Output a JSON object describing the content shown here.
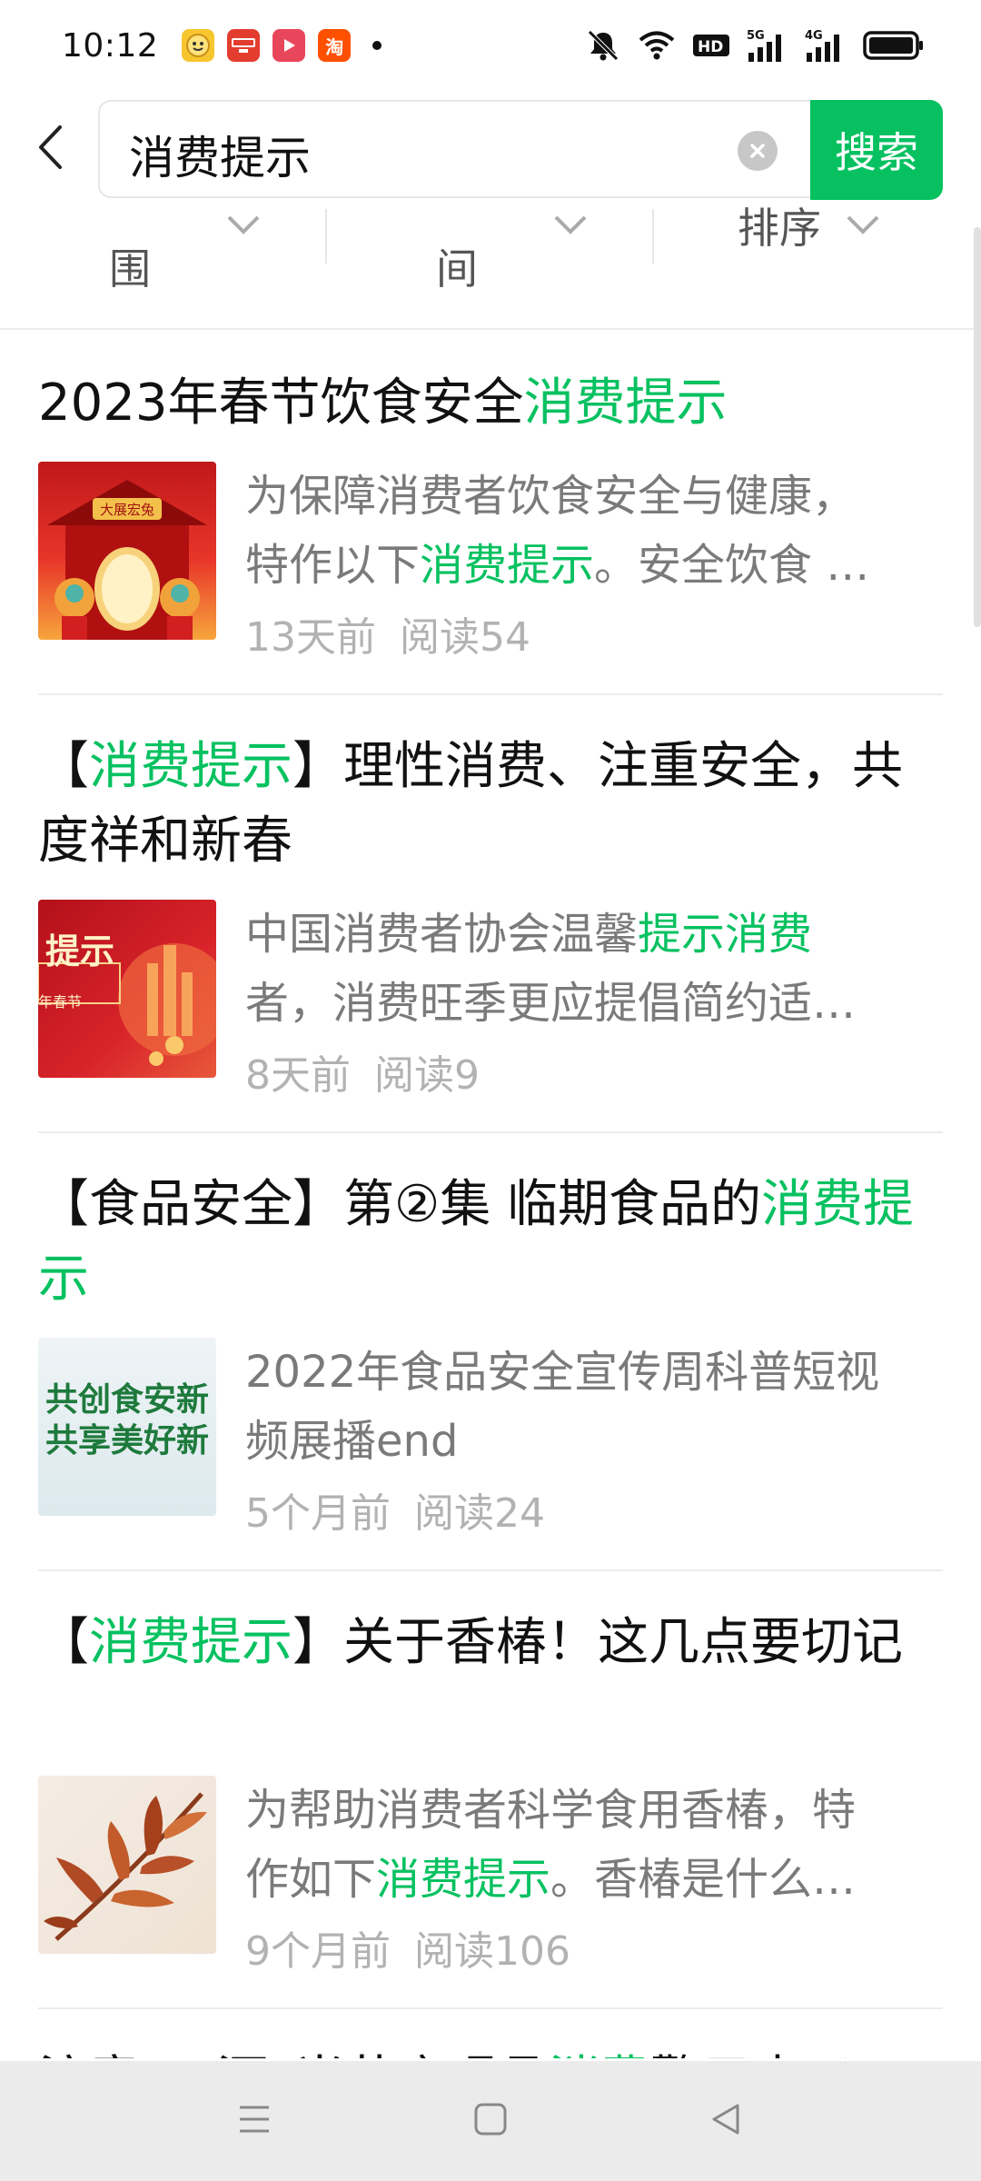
{
  "status_bar": {
    "time": "10:12",
    "notification_icons": [
      "smiley-app-icon",
      "news-app-icon",
      "video-app-icon",
      "taobao-app-icon"
    ],
    "taobao_label": "淘",
    "system_icons": [
      "mute-icon",
      "wifi-icon",
      "hd-icon",
      "signal-5g-icon",
      "signal-4g-icon",
      "battery-icon"
    ]
  },
  "search": {
    "query": "消费提示",
    "button_label": "搜索"
  },
  "filters": {
    "range_label": "围",
    "time_label": "间",
    "sort_label": "排序"
  },
  "results": [
    {
      "title_parts": [
        {
          "text": "2023年春节饮食安全",
          "hl": false
        },
        {
          "text": "消费提示",
          "hl": true
        }
      ],
      "desc_line1": [
        {
          "text": "为保障消费者饮食安全与健康，",
          "hl": false
        }
      ],
      "desc_line2": [
        {
          "text": "特作以下",
          "hl": false
        },
        {
          "text": "消费提示",
          "hl": true
        },
        {
          "text": "。安全饮食 …",
          "hl": false
        }
      ],
      "time": "13天前",
      "reads": "阅读54",
      "thumb_text": "大展宏兔"
    },
    {
      "title_parts": [
        {
          "text": "【",
          "hl": false
        },
        {
          "text": "消费提示",
          "hl": true
        },
        {
          "text": "】理性消费、注重安全，共度祥和新春",
          "hl": false
        }
      ],
      "desc_line1": [
        {
          "text": "中国消费者协会温馨",
          "hl": false
        },
        {
          "text": "提示消费",
          "hl": true
        }
      ],
      "desc_line2": [
        {
          "text": "者，消费旺季更应提倡简约适…",
          "hl": false
        }
      ],
      "time": "8天前",
      "reads": "阅读9",
      "thumb_text": "提示",
      "thumb_sub": "年春节"
    },
    {
      "title_parts": [
        {
          "text": "【食品安全】第②集 临期食品的",
          "hl": false
        },
        {
          "text": "消费提示",
          "hl": true
        }
      ],
      "desc_line1": [
        {
          "text": "2022年食品安全宣传周科普短视",
          "hl": false
        }
      ],
      "desc_line2": [
        {
          "text": "频展播end",
          "hl": false
        }
      ],
      "time": "5个月前",
      "reads": "阅读24",
      "thumb_text": "共创食安新",
      "thumb_sub": "共享美好新"
    },
    {
      "title_parts": [
        {
          "text": "【",
          "hl": false
        },
        {
          "text": "消费提示",
          "hl": true
        },
        {
          "text": "】关于香椿！这几点要切记",
          "hl": false
        }
      ],
      "desc_line1": [
        {
          "text": "为帮助消费者科学食用香椿，特",
          "hl": false
        }
      ],
      "desc_line2": [
        {
          "text": "作如下",
          "hl": false
        },
        {
          "text": "消费提示",
          "hl": true
        },
        {
          "text": "。香椿是什么…",
          "hl": false
        }
      ],
      "time": "9个月前",
      "reads": "阅读106"
    },
    {
      "title_parts": [
        {
          "text": "注意！“酒”当节庆喝品",
          "hl": false
        },
        {
          "text": "消费",
          "hl": true
        },
        {
          "text": "警示来了",
          "hl": false
        }
      ]
    }
  ],
  "colors": {
    "accent": "#07c160",
    "desc": "#7a7a7a",
    "meta": "#b2b2b2"
  }
}
